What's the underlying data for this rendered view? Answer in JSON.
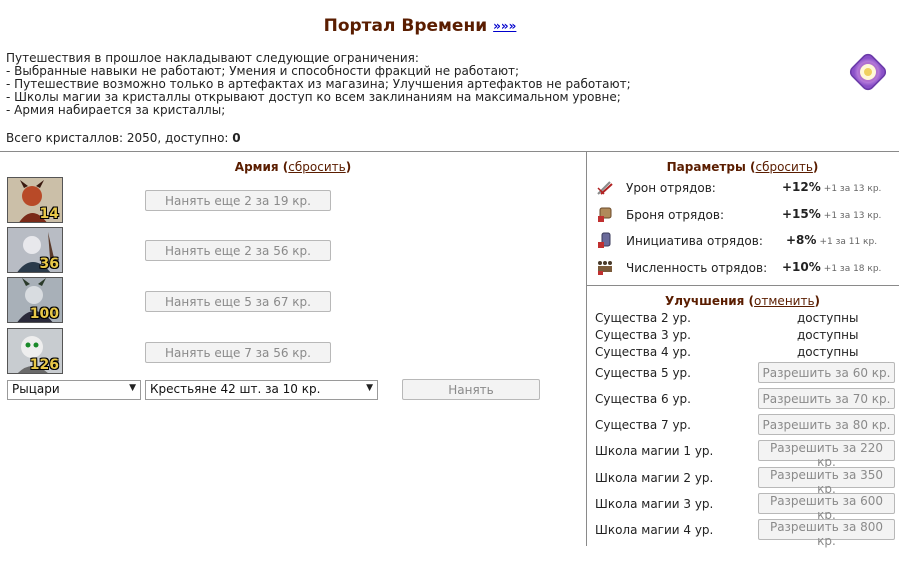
{
  "header": {
    "title": "Портал Времени",
    "link": "»»»"
  },
  "intro": {
    "lines": [
      "Путешествия в прошлое накладывают следующие ограничения:",
      "- Выбранные навыки не работают; Умения и способности фракций не работают;",
      "- Путешествие возможно только в артефактах из магазина; Улучшения артефактов не работают;",
      "- Школы магии за кристаллы открывают доступ ко всем заклинаниям на максимальном уровне;",
      "- Армия набирается за кристаллы;"
    ],
    "crystals_prefix": "Всего кристаллов: 2050, доступно: ",
    "crystals_available": "0"
  },
  "army": {
    "title": "Армия",
    "reset": "сбросить",
    "units": [
      {
        "level": "14",
        "button": "Нанять еще 2 за 19 кр."
      },
      {
        "level": "36",
        "button": "Нанять еще 2 за 56 кр."
      },
      {
        "level": "100",
        "button": "Нанять еще 5 за 67 кр."
      },
      {
        "level": "126",
        "button": "Нанять еще 7 за 56 кр."
      }
    ],
    "faction_select": "Рыцари",
    "creature_select": "Крестьяне 42 шт. за 10 кр.",
    "hire_button": "Нанять"
  },
  "params": {
    "title": "Параметры",
    "reset": "сбросить",
    "items": [
      {
        "label": "Урон отрядов:",
        "value": "+12%",
        "note": "+1 за 13 кр.",
        "icon": "damage-icon"
      },
      {
        "label": "Броня отрядов:",
        "value": "+15%",
        "note": "+1 за 13 кр.",
        "icon": "armor-icon"
      },
      {
        "label": "Инициатива отрядов:",
        "value": "+8%",
        "note": "+1 за 11 кр.",
        "icon": "initiative-icon"
      },
      {
        "label": "Численность отрядов:",
        "value": "+10%",
        "note": "+1 за 18 кр.",
        "icon": "count-icon"
      }
    ]
  },
  "upgrades": {
    "title": "Улучшения",
    "cancel": "отменить",
    "available": [
      {
        "label": "Существа 2 ур.",
        "status": "доступны"
      },
      {
        "label": "Существа 3 ур.",
        "status": "доступны"
      },
      {
        "label": "Существа 4 ур.",
        "status": "доступны"
      }
    ],
    "purchasable": [
      {
        "label": "Существа 5 ур.",
        "button": "Разрешить за 60 кр."
      },
      {
        "label": "Существа 6 ур.",
        "button": "Разрешить за 70 кр."
      },
      {
        "label": "Существа 7 ур.",
        "button": "Разрешить за 80 кр."
      },
      {
        "label": "Школа магии 1 ур.",
        "button": "Разрешить за 220 кр."
      },
      {
        "label": "Школа магии 2 ур.",
        "button": "Разрешить за 350 кр."
      },
      {
        "label": "Школа магии 3 ур.",
        "button": "Разрешить за 600 кр."
      },
      {
        "label": "Школа магии 4 ур.",
        "button": "Разрешить за 800 кр."
      }
    ]
  }
}
